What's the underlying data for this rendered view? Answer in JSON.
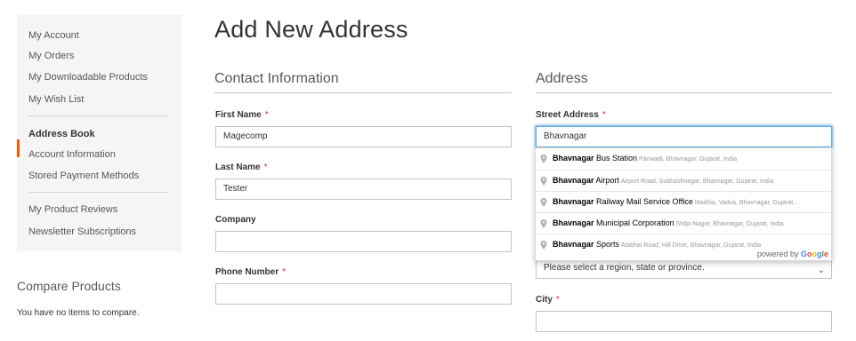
{
  "sidebar": {
    "items": [
      {
        "label": "My Account"
      },
      {
        "label": "My Orders"
      },
      {
        "label": "My Downloadable Products"
      },
      {
        "label": "My Wish List"
      },
      {
        "label": "Address Book"
      },
      {
        "label": "Account Information"
      },
      {
        "label": "Stored Payment Methods"
      },
      {
        "label": "My Product Reviews"
      },
      {
        "label": "Newsletter Subscriptions"
      }
    ],
    "current": "Address Book"
  },
  "compare": {
    "title": "Compare Products",
    "empty_text": "You have no items to compare."
  },
  "page": {
    "title": "Add New Address"
  },
  "contact": {
    "title": "Contact Information",
    "first_name": {
      "label": "First Name",
      "value": "Magecomp",
      "required": "*"
    },
    "last_name": {
      "label": "Last Name",
      "value": "Tester",
      "required": "*"
    },
    "company": {
      "label": "Company",
      "value": ""
    },
    "phone": {
      "label": "Phone Number",
      "value": "",
      "required": "*"
    }
  },
  "address": {
    "title": "Address",
    "street": {
      "label": "Street Address",
      "value": "Bhavnagar",
      "required": "*"
    },
    "region": {
      "placeholder": "Please select a region, state or province."
    },
    "city": {
      "label": "City",
      "value": "",
      "required": "*"
    }
  },
  "autocomplete": {
    "items": [
      {
        "match": "Bhavnagar",
        "rest": " Bus Station",
        "secondary": "Panwadi, Bhavnagar, Gujarat, India"
      },
      {
        "match": "Bhavnagar",
        "rest": " Airport",
        "secondary": "Airport Road, Subhashnagar, Bhavnagar, Gujarat, India"
      },
      {
        "match": "Bhavnagar",
        "rest": " Railway Mail Service Office",
        "secondary": "Madhia, Vadva, Bhavnagar, Gujarat..."
      },
      {
        "match": "Bhavnagar",
        "rest": " Municipal Corporation",
        "secondary": "Shilpi Nagar, Bhavnagar, Gujarat, India"
      },
      {
        "match": "Bhavnagar",
        "rest": " Sports",
        "secondary": "Atabhai Road, Hill Drive, Bhavnagar, Gujarat, India"
      }
    ],
    "footer_prefix": "powered by",
    "logo": [
      "G",
      "o",
      "o",
      "g",
      "l",
      "e"
    ],
    "logo_colors": [
      "#4285f4",
      "#ea4335",
      "#fbbc05",
      "#4285f4",
      "#34a853",
      "#ea4335"
    ]
  },
  "colors": {
    "accent": "#ff5501",
    "required": "#e02b27",
    "focus": "#68a8e0"
  }
}
